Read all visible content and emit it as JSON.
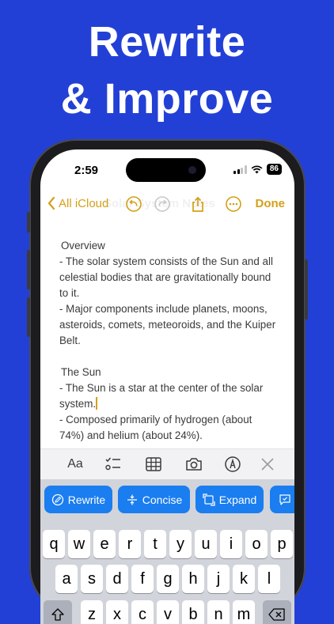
{
  "headline": {
    "line1": "Rewrite",
    "line2": "& Improve"
  },
  "status_bar": {
    "time": "2:59",
    "battery": "86"
  },
  "nav": {
    "back_label": "All iCloud",
    "ghost_title": "Solar System Notes",
    "done_label": "Done"
  },
  "note": {
    "lines": [
      "Overview",
      "- The solar system consists of the Sun and all",
      "celestial bodies that are gravitationally bound",
      "to it.",
      "- Major components include planets, moons,",
      "asteroids, comets, meteoroids, and the Kuiper",
      "Belt.",
      "",
      "The Sun",
      "- The Sun is a star at the center of the solar",
      "system.",
      "- Composed primarily of hydrogen (about",
      "74%) and helium (about 24%)."
    ]
  },
  "toolbar": {
    "format_label": "Aa"
  },
  "ai_actions": {
    "rewrite": "Rewrite",
    "concise": "Concise",
    "expand": "Expand"
  },
  "keyboard": {
    "row1": [
      "q",
      "w",
      "e",
      "r",
      "t",
      "y",
      "u",
      "i",
      "o",
      "p"
    ],
    "row2": [
      "a",
      "s",
      "d",
      "f",
      "g",
      "h",
      "j",
      "k",
      "l"
    ],
    "row3": [
      "z",
      "x",
      "c",
      "v",
      "b",
      "n",
      "m"
    ]
  },
  "colors": {
    "background": "#2340d6",
    "accent": "#d4a017",
    "ai_button": "#1a7df0"
  }
}
